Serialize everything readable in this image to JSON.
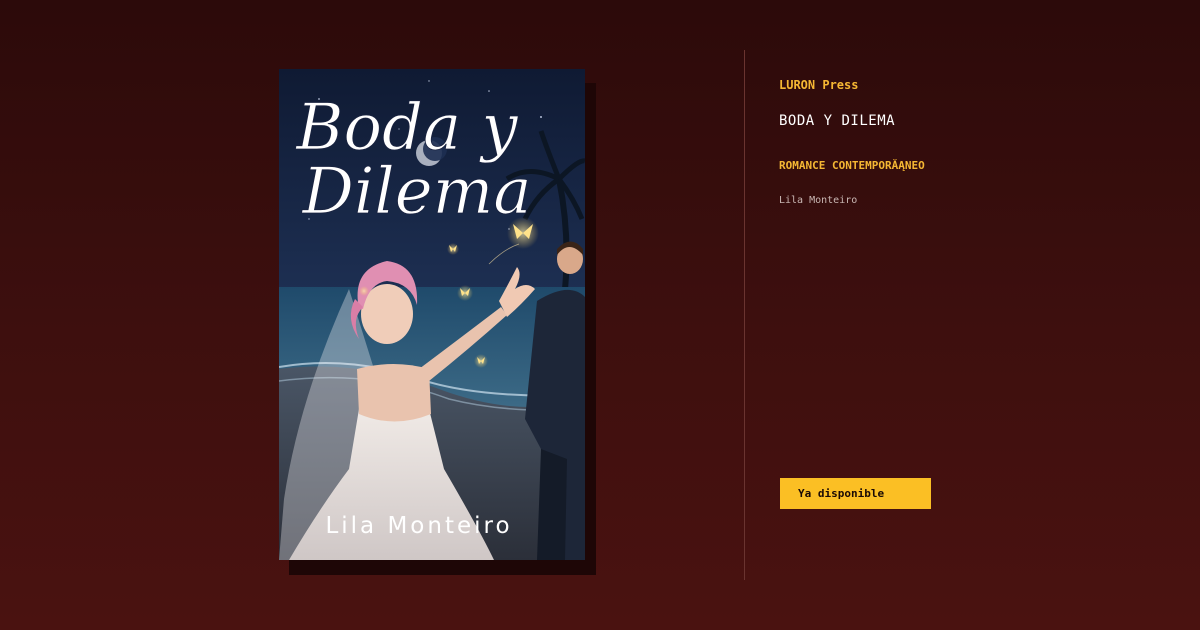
{
  "book": {
    "cover_title_line1": "Boda y",
    "cover_title_line2": "Dilema",
    "cover_author": "Lila Monteiro"
  },
  "info": {
    "publisher": "LURON Press",
    "title": "BODA Y DILEMA",
    "genre": "ROMANCE CONTEMPORĂĄNEO",
    "author": "Lila Monteiro"
  },
  "cta": {
    "label": "Ya disponible"
  },
  "colors": {
    "accent": "#fbbf24",
    "label_color": "#f5b733",
    "background": "#3d0f0e"
  }
}
